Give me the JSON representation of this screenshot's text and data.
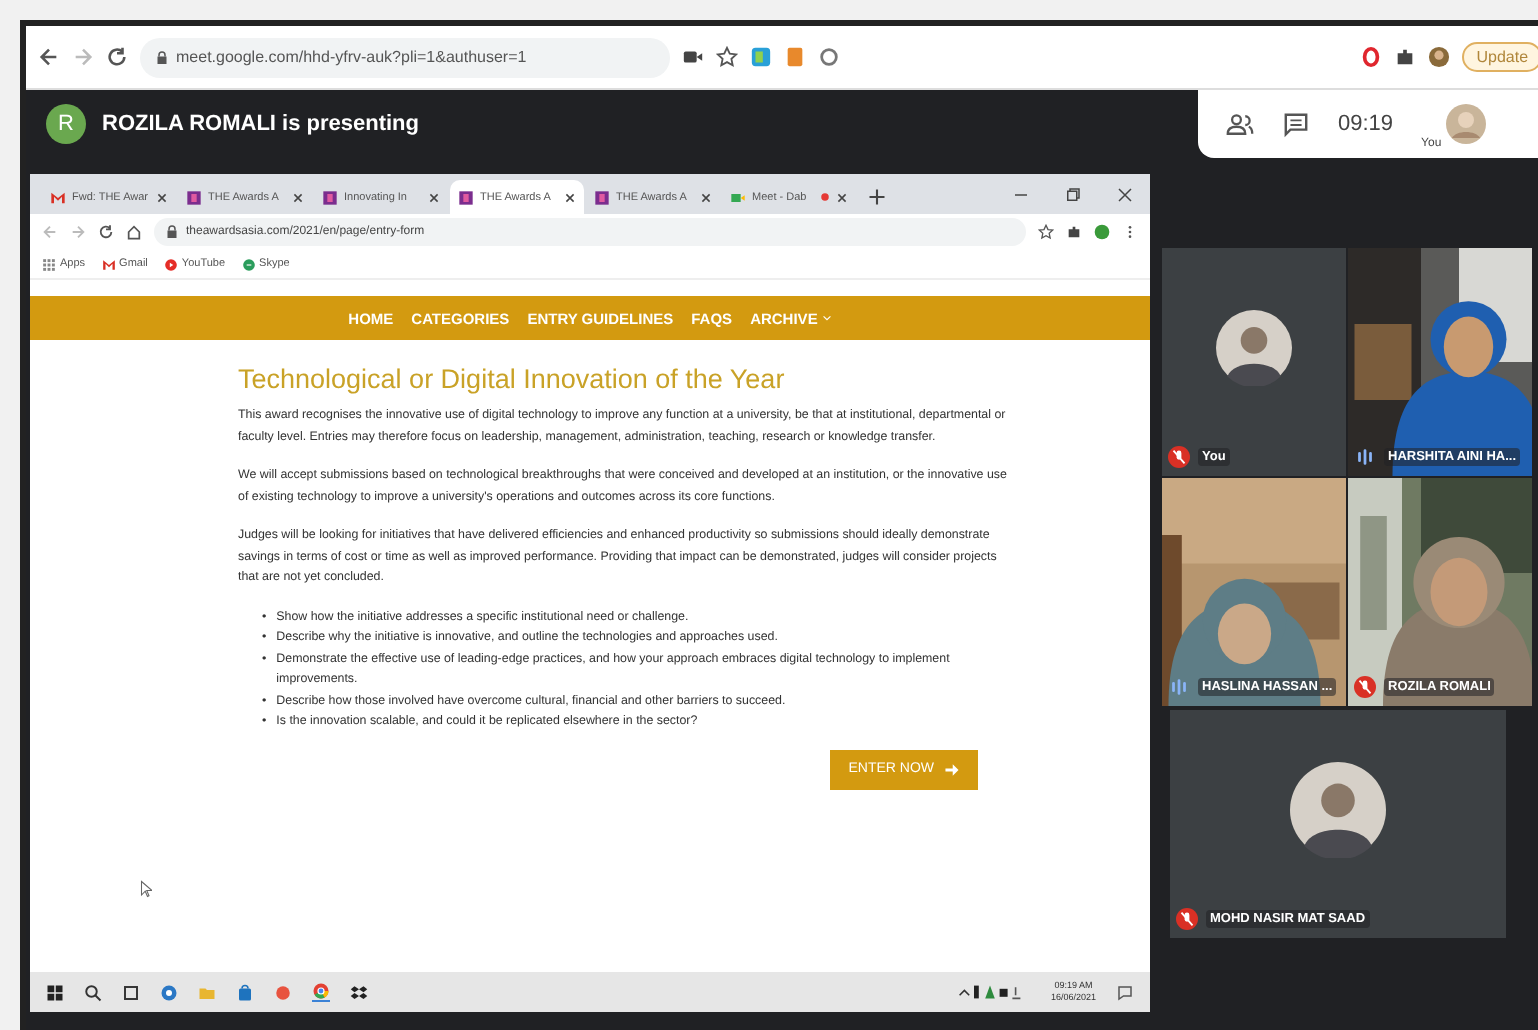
{
  "browser": {
    "url": "meet.google.com/hhd-yfrv-auk?pli=1&authuser=1",
    "update_label": "Update"
  },
  "meet": {
    "presenter_initial": "R",
    "presenting_text": "ROZILA ROMALI is presenting",
    "clock": "09:19",
    "self_label": "You"
  },
  "shared_screen": {
    "tabs": [
      {
        "label": "Fwd: THE Awar",
        "selected": false,
        "kind": "mail"
      },
      {
        "label": "THE Awards A",
        "selected": false,
        "kind": "site"
      },
      {
        "label": "Innovating In",
        "selected": false,
        "kind": "site"
      },
      {
        "label": "THE Awards A",
        "selected": true,
        "kind": "site"
      },
      {
        "label": "THE Awards A",
        "selected": false,
        "kind": "site"
      },
      {
        "label": "Meet - Dab",
        "selected": false,
        "kind": "meet"
      }
    ],
    "url": "theawardsasia.com/2021/en/page/entry-form",
    "bookmarks": [
      {
        "label": "Apps",
        "kind": "apps"
      },
      {
        "label": "Gmail",
        "kind": "mail"
      },
      {
        "label": "YouTube",
        "kind": "video"
      },
      {
        "label": "Skype",
        "kind": "chat"
      }
    ],
    "nav": [
      {
        "label": "HOME",
        "dropdown": false
      },
      {
        "label": "CATEGORIES",
        "dropdown": false
      },
      {
        "label": "ENTRY GUIDELINES",
        "dropdown": false
      },
      {
        "label": "FAQS",
        "dropdown": false
      },
      {
        "label": "ARCHIVE",
        "dropdown": true
      }
    ],
    "heading": "Technological or Digital Innovation of the Year",
    "paragraphs": [
      "This award recognises the innovative use of digital technology to improve any function at a university, be that at institutional, departmental or faculty level. Entries may therefore focus on leadership, management, administration, teaching, research or knowledge transfer.",
      "We will accept submissions based on technological breakthroughs that were conceived and developed at an institution, or the innovative use of existing technology to improve a university's operations and outcomes across its core functions.",
      "Judges will be looking for initiatives that have delivered efficiencies and enhanced productivity so submissions should ideally demonstrate savings in terms of cost or time as well as improved performance. Providing that impact can be demonstrated, judges will consider projects that are not yet concluded."
    ],
    "bullets": [
      {
        "marker": "•",
        "text": "Show how the initiative addresses a specific institutional need or challenge."
      },
      {
        "marker": "•",
        "text": "Describe why the initiative is innovative, and outline the technologies and approaches used."
      },
      {
        "marker": "•",
        "text": "Demonstrate the effective use of leading-edge practices, and how your approach embraces digital technology to implement improvements."
      },
      {
        "marker": "•",
        "text": "Describe how those involved have overcome cultural, financial and other barriers to succeed."
      },
      {
        "marker": "•",
        "text": "Is the innovation scalable, and could it be replicated elsewhere in the sector?"
      }
    ],
    "button": "ENTER NOW",
    "taskbar": {
      "time": "09:19 AM",
      "date": "16/06/2021"
    }
  },
  "participants": [
    {
      "name": "You",
      "kind": "avatar",
      "muted": true
    },
    {
      "name": "HARSHITA AINI HA...",
      "kind": "video",
      "muted": false
    },
    {
      "name": "HASLINA HASSAN ...",
      "kind": "video",
      "muted": false
    },
    {
      "name": "ROZILA ROMALI",
      "kind": "video",
      "muted": true
    },
    {
      "name": "MOHD NASIR MAT SAAD",
      "kind": "avatar",
      "muted": true
    }
  ]
}
